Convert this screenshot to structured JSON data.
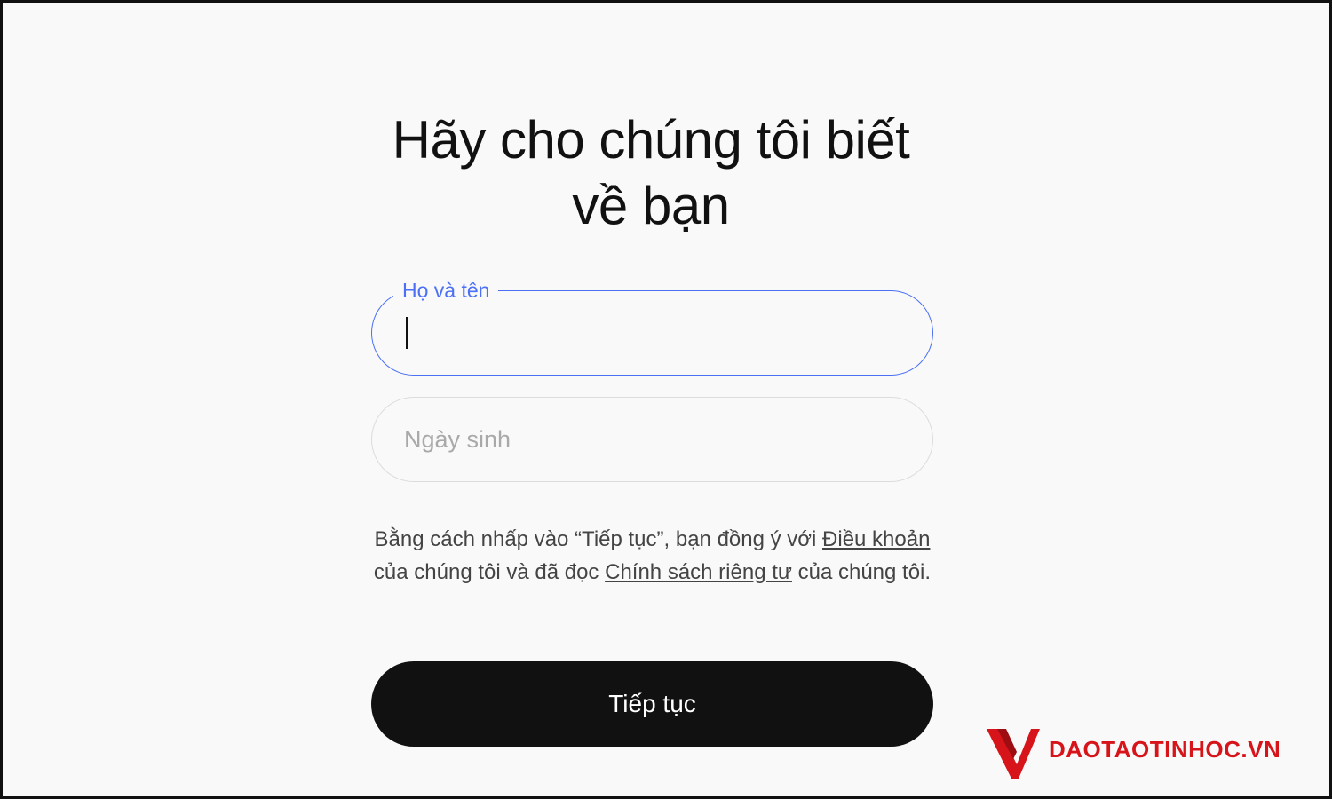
{
  "header": {
    "title_line1": "Hãy cho chúng tôi biết",
    "title_line2": "về bạn"
  },
  "form": {
    "name_field": {
      "label": "Họ và tên",
      "value": ""
    },
    "dob_field": {
      "placeholder": "Ngày sinh",
      "value": ""
    }
  },
  "legal": {
    "text_before": "Bằng cách nhấp vào “Tiếp tục”, bạn đồng ý với ",
    "terms_link": "Điều khoản",
    "text_middle": " của chúng tôi và đã đọc ",
    "privacy_link": "Chính sách riêng tư",
    "text_after": " của chúng tôi."
  },
  "actions": {
    "continue_label": "Tiếp tục"
  },
  "watermark": {
    "text": "DAOTAOTINHOC.VN",
    "color": "#d7141a"
  },
  "colors": {
    "accent": "#4b70f5",
    "button": "#111111",
    "background": "#f9f9f9"
  }
}
